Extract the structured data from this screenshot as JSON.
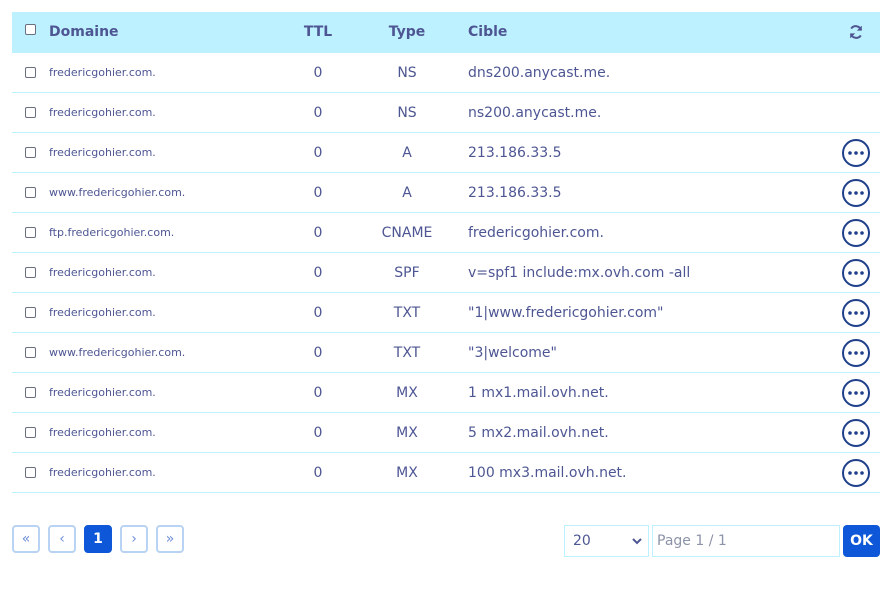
{
  "header": {
    "domain": "Domaine",
    "ttl": "TTL",
    "type": "Type",
    "target": "Cible",
    "refresh_icon": "refresh-icon"
  },
  "rows": [
    {
      "domain": "fredericgohier.com.",
      "ttl": "0",
      "type": "NS",
      "target": "dns200.anycast.me.",
      "has_actions": false
    },
    {
      "domain": "fredericgohier.com.",
      "ttl": "0",
      "type": "NS",
      "target": "ns200.anycast.me.",
      "has_actions": false
    },
    {
      "domain": "fredericgohier.com.",
      "ttl": "0",
      "type": "A",
      "target": "213.186.33.5",
      "has_actions": true
    },
    {
      "domain": "www.fredericgohier.com.",
      "ttl": "0",
      "type": "A",
      "target": "213.186.33.5",
      "has_actions": true
    },
    {
      "domain": "ftp.fredericgohier.com.",
      "ttl": "0",
      "type": "CNAME",
      "target": "fredericgohier.com.",
      "has_actions": true
    },
    {
      "domain": "fredericgohier.com.",
      "ttl": "0",
      "type": "SPF",
      "target": "v=spf1 include:mx.ovh.com -all",
      "has_actions": true
    },
    {
      "domain": "fredericgohier.com.",
      "ttl": "0",
      "type": "TXT",
      "target": "\"1|www.fredericgohier.com\"",
      "has_actions": true
    },
    {
      "domain": "www.fredericgohier.com.",
      "ttl": "0",
      "type": "TXT",
      "target": "\"3|welcome\"",
      "has_actions": true
    },
    {
      "domain": "fredericgohier.com.",
      "ttl": "0",
      "type": "MX",
      "target": "1 mx1.mail.ovh.net.",
      "has_actions": true
    },
    {
      "domain": "fredericgohier.com.",
      "ttl": "0",
      "type": "MX",
      "target": "5 mx2.mail.ovh.net.",
      "has_actions": true
    },
    {
      "domain": "fredericgohier.com.",
      "ttl": "0",
      "type": "MX",
      "target": "100 mx3.mail.ovh.net.",
      "has_actions": true
    }
  ],
  "pagination": {
    "first": "«",
    "prev": "‹",
    "current": "1",
    "next": "›",
    "last": "»",
    "page_size": "20",
    "page_placeholder": "Page 1 / 1",
    "ok": "OK"
  },
  "colors": {
    "header_bg": "#bef1ff",
    "accent": "#0d57d8",
    "text": "#4d5693",
    "action_border": "#1e3f8a"
  }
}
